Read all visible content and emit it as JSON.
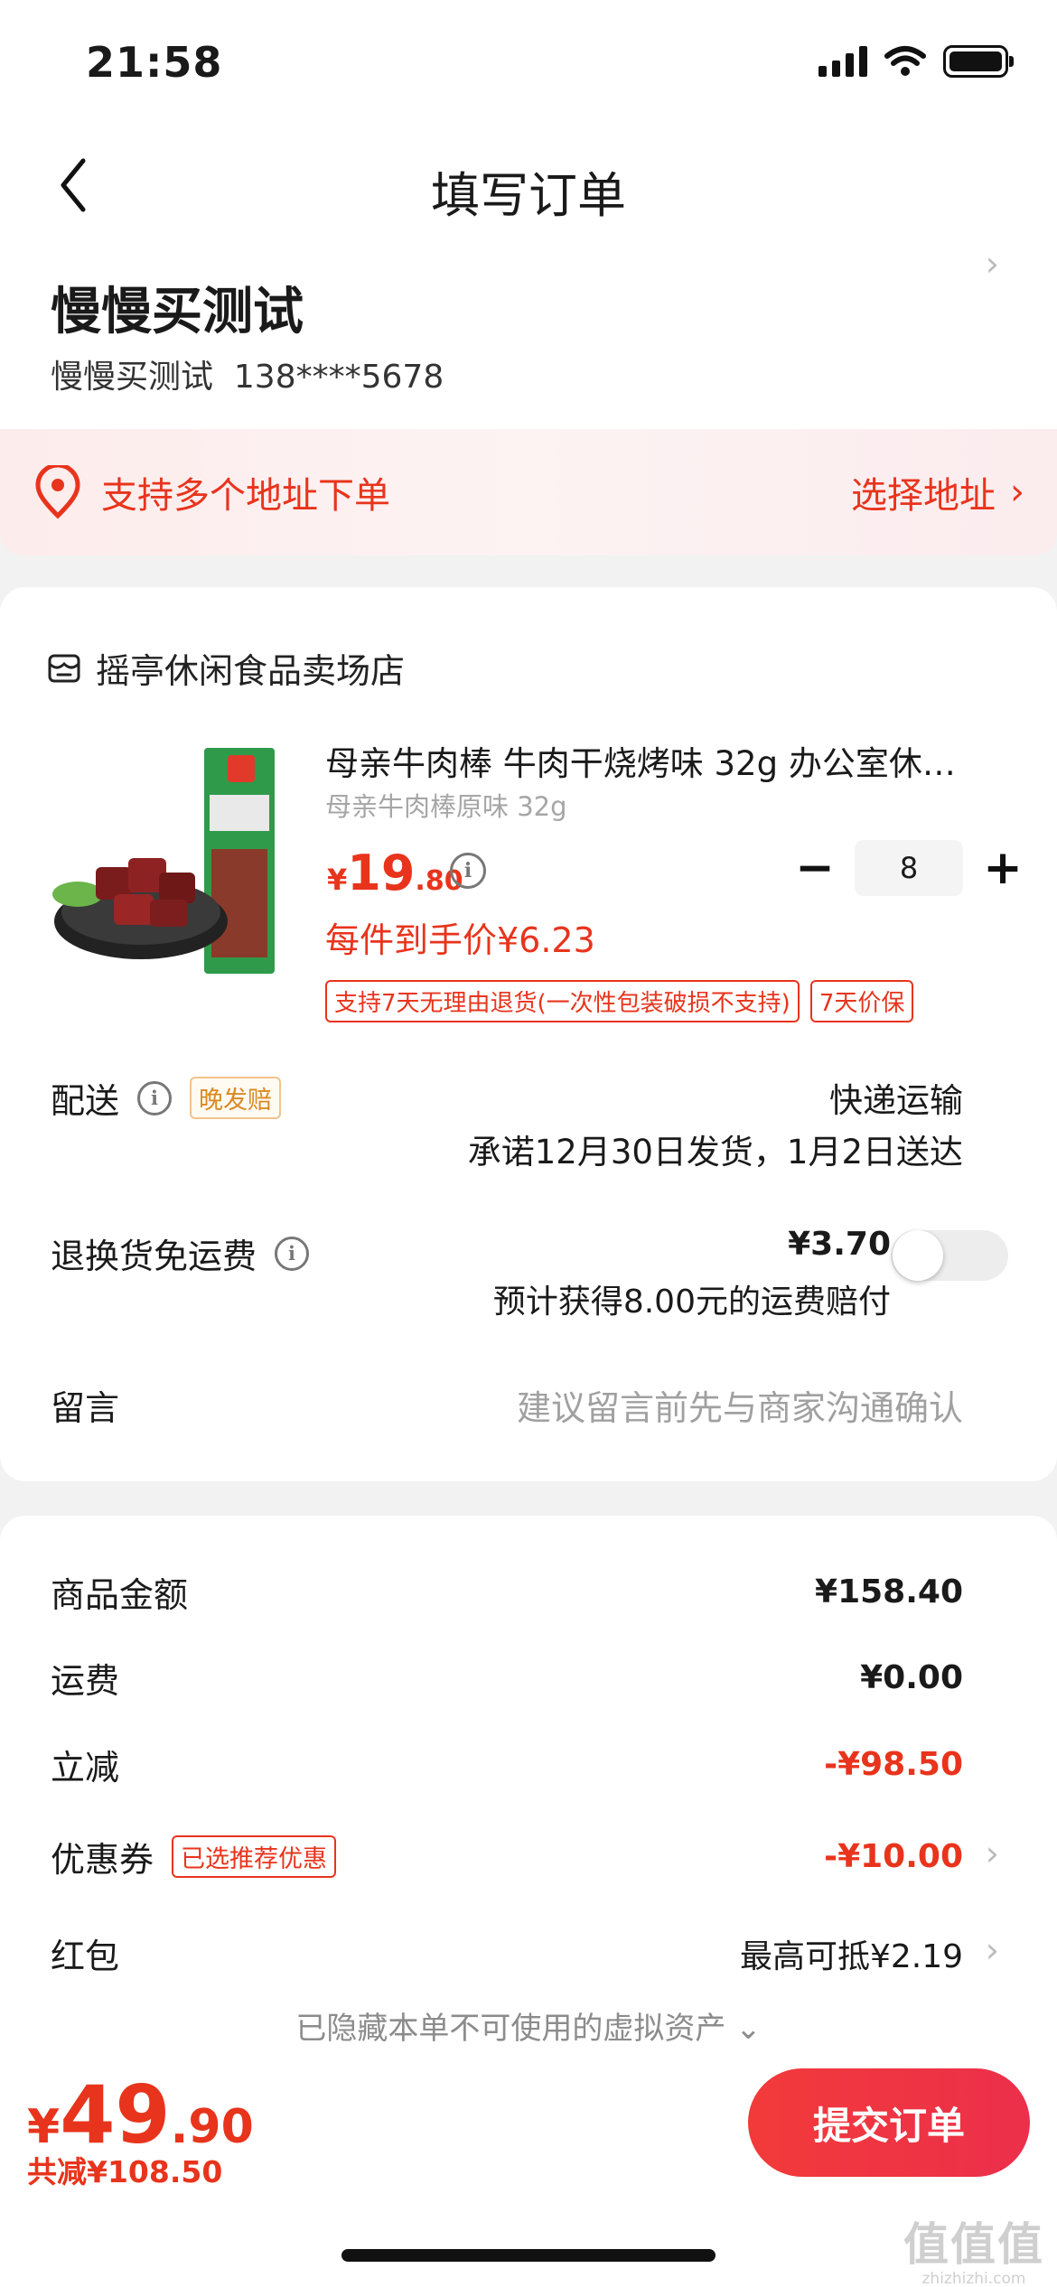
{
  "status_bar": {
    "time": "21:58"
  },
  "header": {
    "title": "填写订单"
  },
  "recipient": {
    "name": "慢慢买测试",
    "contact_name": "慢慢买测试",
    "phone": "138****5678"
  },
  "address_banner": {
    "text": "支持多个地址下单",
    "action": "选择地址"
  },
  "store": {
    "name": "摇亭休闲食品卖场店"
  },
  "product": {
    "title": "母亲牛肉棒 牛肉干烧烤味 32g 办公室休…",
    "spec": "母亲牛肉棒原味 32g",
    "price_symbol": "¥",
    "price_int": "19",
    "price_dec": ".80",
    "unit_price_text": "每件到手价¥6.23",
    "quantity": "8",
    "tags": [
      "支持7天无理由退货(一次性包装破损不支持)",
      "7天价保"
    ]
  },
  "delivery": {
    "label": "配送",
    "tag": "晚发赔",
    "method": "快递运输",
    "promise": "承诺12月30日发货，1月2日送达"
  },
  "return_shipping": {
    "label": "退换货免运费",
    "price": "¥3.70",
    "note": "预计获得8.00元的运费赔付"
  },
  "message": {
    "label": "留言",
    "placeholder": "建议留言前先与商家沟通确认"
  },
  "summary": {
    "goods_label": "商品金额",
    "goods_value": "¥158.40",
    "shipping_label": "运费",
    "shipping_value": "¥0.00",
    "discount_label": "立减",
    "discount_value": "-¥98.50",
    "coupon_label": "优惠券",
    "coupon_tag": "已选推荐优惠",
    "coupon_value": "-¥10.00",
    "redpacket_label": "红包",
    "redpacket_value": "最高可抵¥2.19",
    "hidden_assets": "已隐藏本单不可使用的虚拟资产"
  },
  "footer": {
    "total_symbol": "¥",
    "total_int": "49",
    "total_dec": ".90",
    "saved": "共减¥108.50",
    "submit_label": "提交订单"
  },
  "watermark": {
    "text": "值值值",
    "url": "zhizhizhi.com"
  },
  "colors": {
    "accent": "#e8341c",
    "background": "#f2f2f2",
    "card": "#ffffff"
  }
}
